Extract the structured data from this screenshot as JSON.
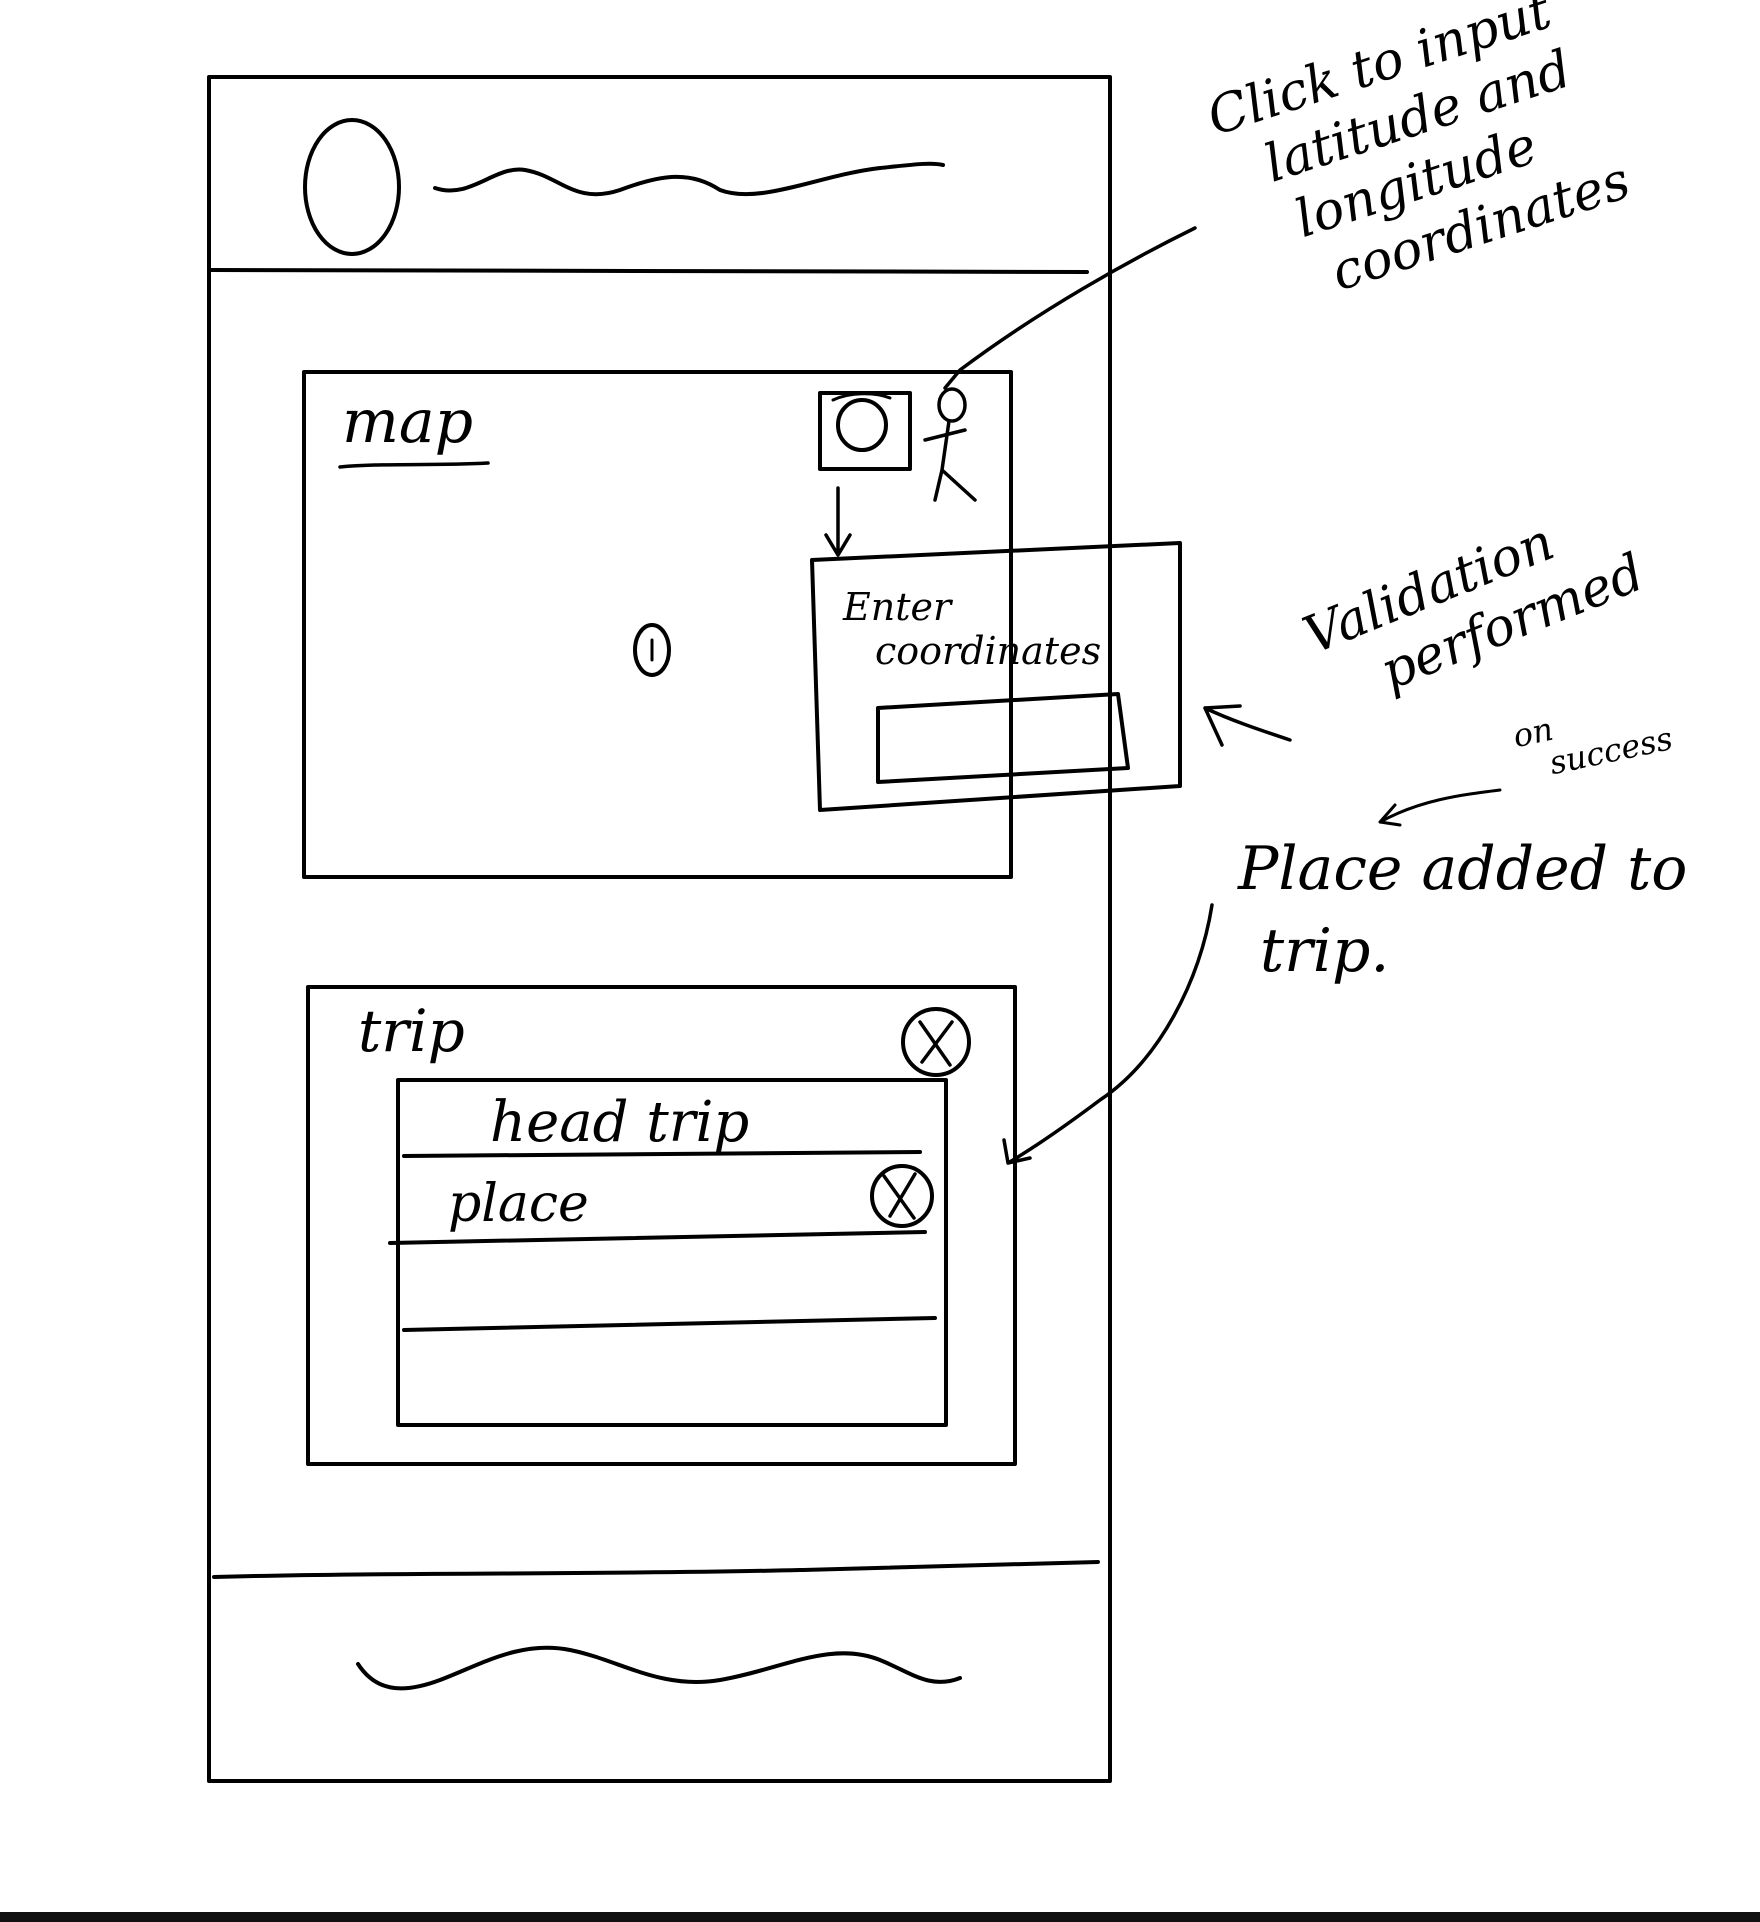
{
  "map_panel": {
    "title": "map"
  },
  "coordinate_popup": {
    "title_line1": "Enter",
    "title_line2": "coordinates"
  },
  "trip_panel": {
    "title": "trip",
    "header_row": "head trip",
    "rows": [
      {
        "label": "place"
      }
    ]
  },
  "annotations": {
    "click_note": [
      "Click to input",
      "latitude and",
      "longitude",
      "coordinates"
    ],
    "validation_note": [
      "Validation",
      "performed"
    ],
    "on_success": [
      "on",
      "success"
    ],
    "place_added": [
      "Place added to",
      "trip."
    ]
  },
  "icons": {
    "logo": "logo-circle-icon",
    "coordinate_button": "coordinate-input-icon",
    "user": "stick-figure-icon",
    "map_marker": "map-marker-icon",
    "close": "close-x-icon"
  }
}
